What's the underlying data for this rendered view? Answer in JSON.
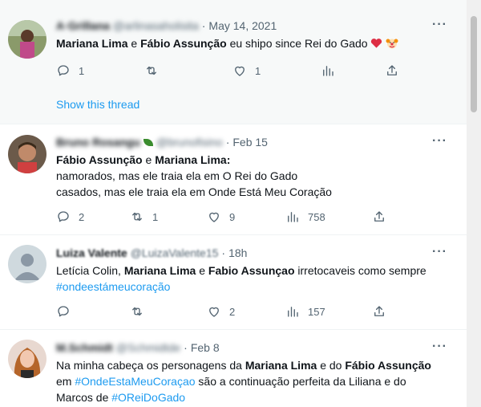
{
  "tweets": [
    {
      "name": "A·Grillana",
      "handle": "@arlinasaholisita",
      "date": "May 14, 2021",
      "text_parts": [
        "Mariana Lima",
        " e ",
        "Fábio Assunção",
        " eu shipo since Rei do Gado "
      ],
      "emoji_names": [
        "red-heart",
        "clown-face"
      ],
      "replies": "1",
      "retweets": "",
      "likes": "1",
      "show_thread": "Show this thread"
    },
    {
      "name": "Bruno Rosangu",
      "handle": "@brunofisino",
      "date": "Feb 15",
      "line1_parts": [
        "Fábio Assunção",
        " e ",
        "Mariana Lima",
        ":"
      ],
      "line2": "namorados, mas ele traia ela em O Rei do Gado",
      "line3": "casados, mas ele traia ela em Onde Está Meu Coração",
      "replies": "2",
      "retweets": "1",
      "likes": "9",
      "views": "758"
    },
    {
      "name": "Luiza Valente",
      "handle": "@LuizaValente15",
      "date": "18h",
      "text_parts": [
        "Letícia Colin, ",
        "Mariana Lima",
        " e ",
        "Fabio Assunçao",
        " irretocaveis como sempre"
      ],
      "hashtag": "#ondeestámeucoração",
      "replies": "",
      "retweets": "",
      "likes": "2",
      "views": "157"
    },
    {
      "name": "M.Schmidt",
      "handle": "@Schmidtde",
      "date": "Feb 8",
      "line1_parts": [
        "Na minha cabeça os personagens da ",
        "Mariana Lima",
        " e do ",
        "Fábio Assunção"
      ],
      "line2_parts": [
        "em ",
        "#OndeEstaMeuCoraçao",
        " são a continuação perfeita da Liliana e do"
      ],
      "line3_parts": [
        "Marcos de ",
        "#OReiDoGado"
      ]
    }
  ],
  "separator": "·",
  "more_glyph": "···",
  "colors": {
    "link": "#1d9bf0",
    "muted": "#536471",
    "text": "#0f1419",
    "highlight_bg": "#f7f9f9"
  }
}
